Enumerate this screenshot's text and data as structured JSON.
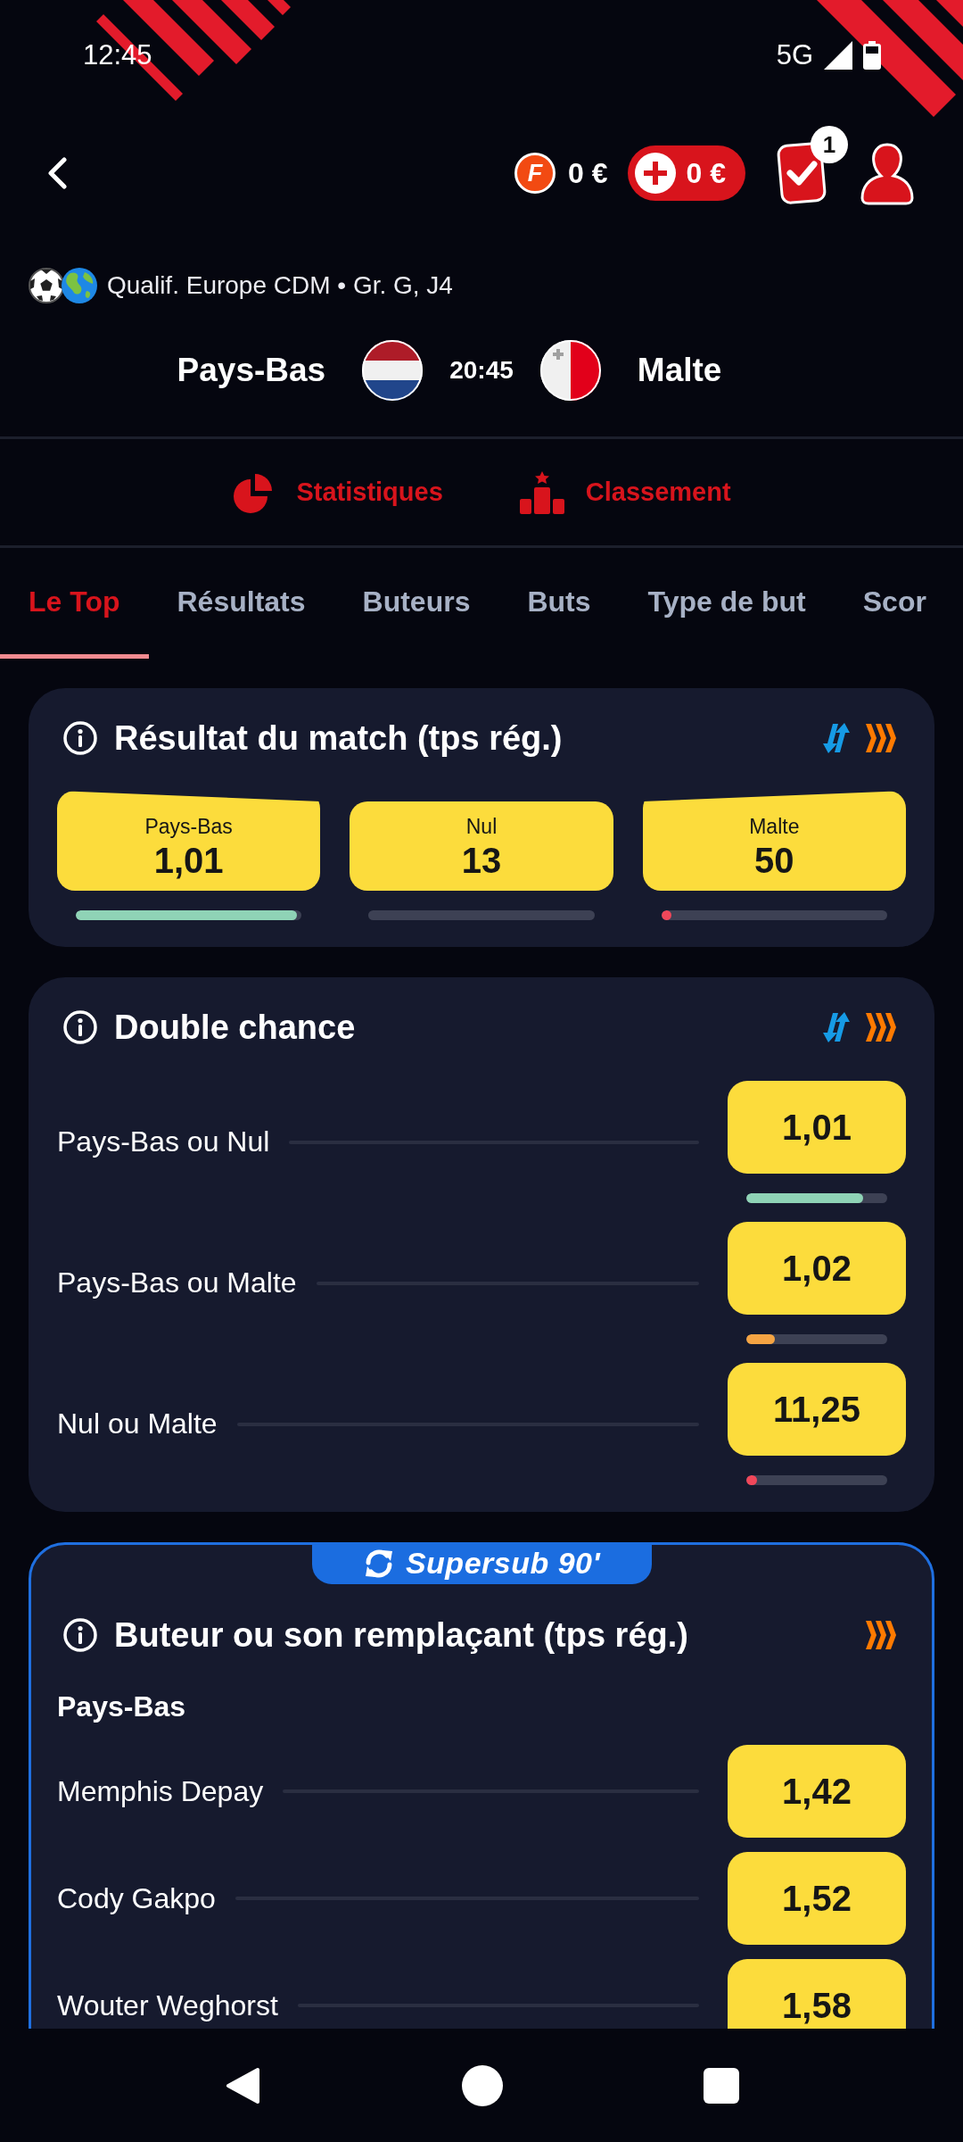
{
  "status_bar": {
    "time": "12:45",
    "network": "5G"
  },
  "header": {
    "freebet": {
      "letter": "F",
      "amount": "0 €"
    },
    "deposit": {
      "amount": "0 €"
    },
    "betslip": {
      "count": "1"
    }
  },
  "match": {
    "competition": "Qualif. Europe CDM • Gr. G, J4",
    "teams": [
      {
        "name": "Pays-Bas",
        "flag": {
          "kind": "horizontal_tricolor"
        }
      },
      {
        "name": "Malte",
        "flag": {
          "kind": "vertical_bicolor"
        }
      }
    ],
    "kickoff": "20:45"
  },
  "links": [
    {
      "kind": "statistics",
      "label": "Statistiques"
    },
    {
      "kind": "standings",
      "label": "Classement"
    }
  ],
  "tabs": [
    {
      "label": "Le Top",
      "selected": true
    },
    {
      "label": "Résultats",
      "selected": false
    },
    {
      "label": "Buteurs",
      "selected": false
    },
    {
      "label": "Buts",
      "selected": false
    },
    {
      "label": "Type de but",
      "selected": false
    },
    {
      "label": "Scor",
      "selected": false
    }
  ],
  "markets": [
    {
      "kind": "three_way",
      "title": "Résultat du match (tps rég.)",
      "highlighted": false,
      "feature_icons": [
        {
          "kind": "arrows"
        },
        {
          "kind": "chevrons"
        }
      ],
      "outcomes": [
        {
          "kind": "raised_left",
          "label": "Pays-Bas",
          "odds": "1,01",
          "level": 0.98,
          "color": "#8fd3b6"
        },
        {
          "kind": "flat",
          "label": "Nul",
          "odds": "13"
        },
        {
          "kind": "raised_right",
          "label": "Malte",
          "odds": "50",
          "level": 0.045,
          "color": "#f0475a"
        }
      ]
    },
    {
      "kind": "list",
      "title": "Double chance",
      "highlighted": false,
      "feature_icons": [
        {
          "kind": "arrows"
        },
        {
          "kind": "chevrons"
        }
      ],
      "sections": [
        {
          "rows": [
            {
              "label": "Pays-Bas ou Nul",
              "odds": "1,01",
              "level": 0.83,
              "color": "#8fd3b6"
            },
            {
              "label": "Pays-Bas ou Malte",
              "odds": "1,02",
              "level": 0.2,
              "color": "#f5a443"
            },
            {
              "label": "Nul ou Malte",
              "odds": "11,25",
              "level": 0.075,
              "color": "#f0475a"
            }
          ]
        }
      ]
    },
    {
      "kind": "list",
      "title": "Buteur ou son remplaçant (tps rég.)",
      "highlighted": true,
      "banner": "Supersub 90'",
      "feature_icons": [
        {
          "kind": "chevrons"
        }
      ],
      "sections": [
        {
          "heading": "Pays-Bas",
          "rows": [
            {
              "label": "Memphis Depay",
              "odds": "1,42"
            },
            {
              "label": "Cody Gakpo",
              "odds": "1,52"
            },
            {
              "label": "Wouter Weghorst",
              "odds": "1,58"
            }
          ]
        }
      ]
    }
  ]
}
